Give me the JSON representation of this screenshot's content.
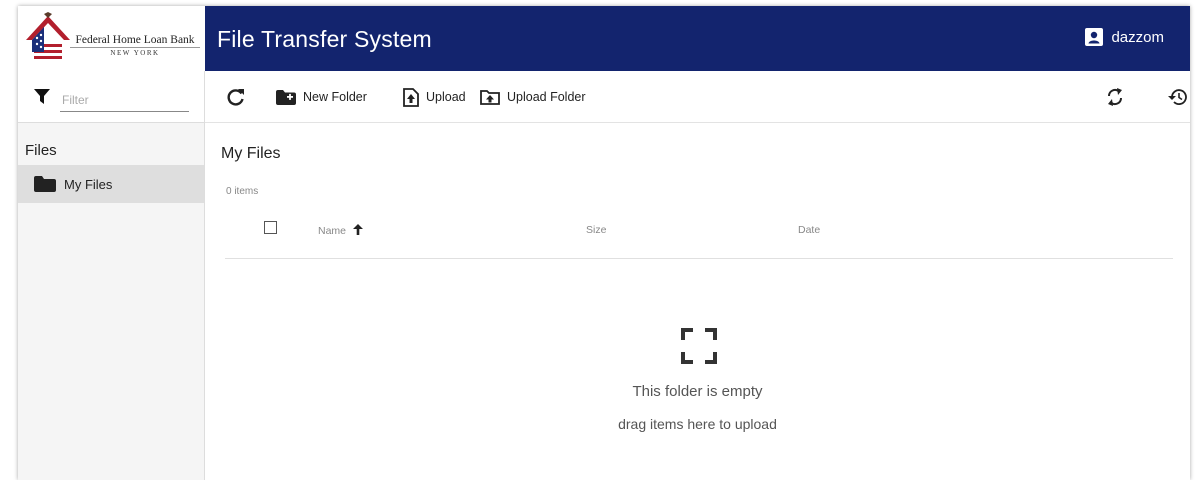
{
  "logo": {
    "line1": "Federal Home Loan Bank",
    "line2": "NEW YORK"
  },
  "header": {
    "title": "File Transfer System",
    "user": "dazzom"
  },
  "filter": {
    "placeholder": "Filter",
    "value": ""
  },
  "sidebar": {
    "title": "Files",
    "items": [
      {
        "label": "My Files",
        "icon": "folder-icon",
        "selected": true
      }
    ]
  },
  "toolbar": {
    "refresh_icon": "refresh-icon",
    "new_folder": "New Folder",
    "upload": "Upload",
    "upload_folder": "Upload Folder",
    "sync_icon": "sync-icon",
    "history_icon": "history-icon"
  },
  "main": {
    "title": "My Files",
    "count": "0 items",
    "columns": {
      "name": "Name",
      "size": "Size",
      "date": "Date"
    },
    "sort": "ascending",
    "empty_title": "This folder is empty",
    "empty_hint": "drag items here to upload"
  },
  "colors": {
    "header_bg": "#13246e",
    "sidebar_bg": "#f5f5f5",
    "selected_bg": "#dedede"
  }
}
